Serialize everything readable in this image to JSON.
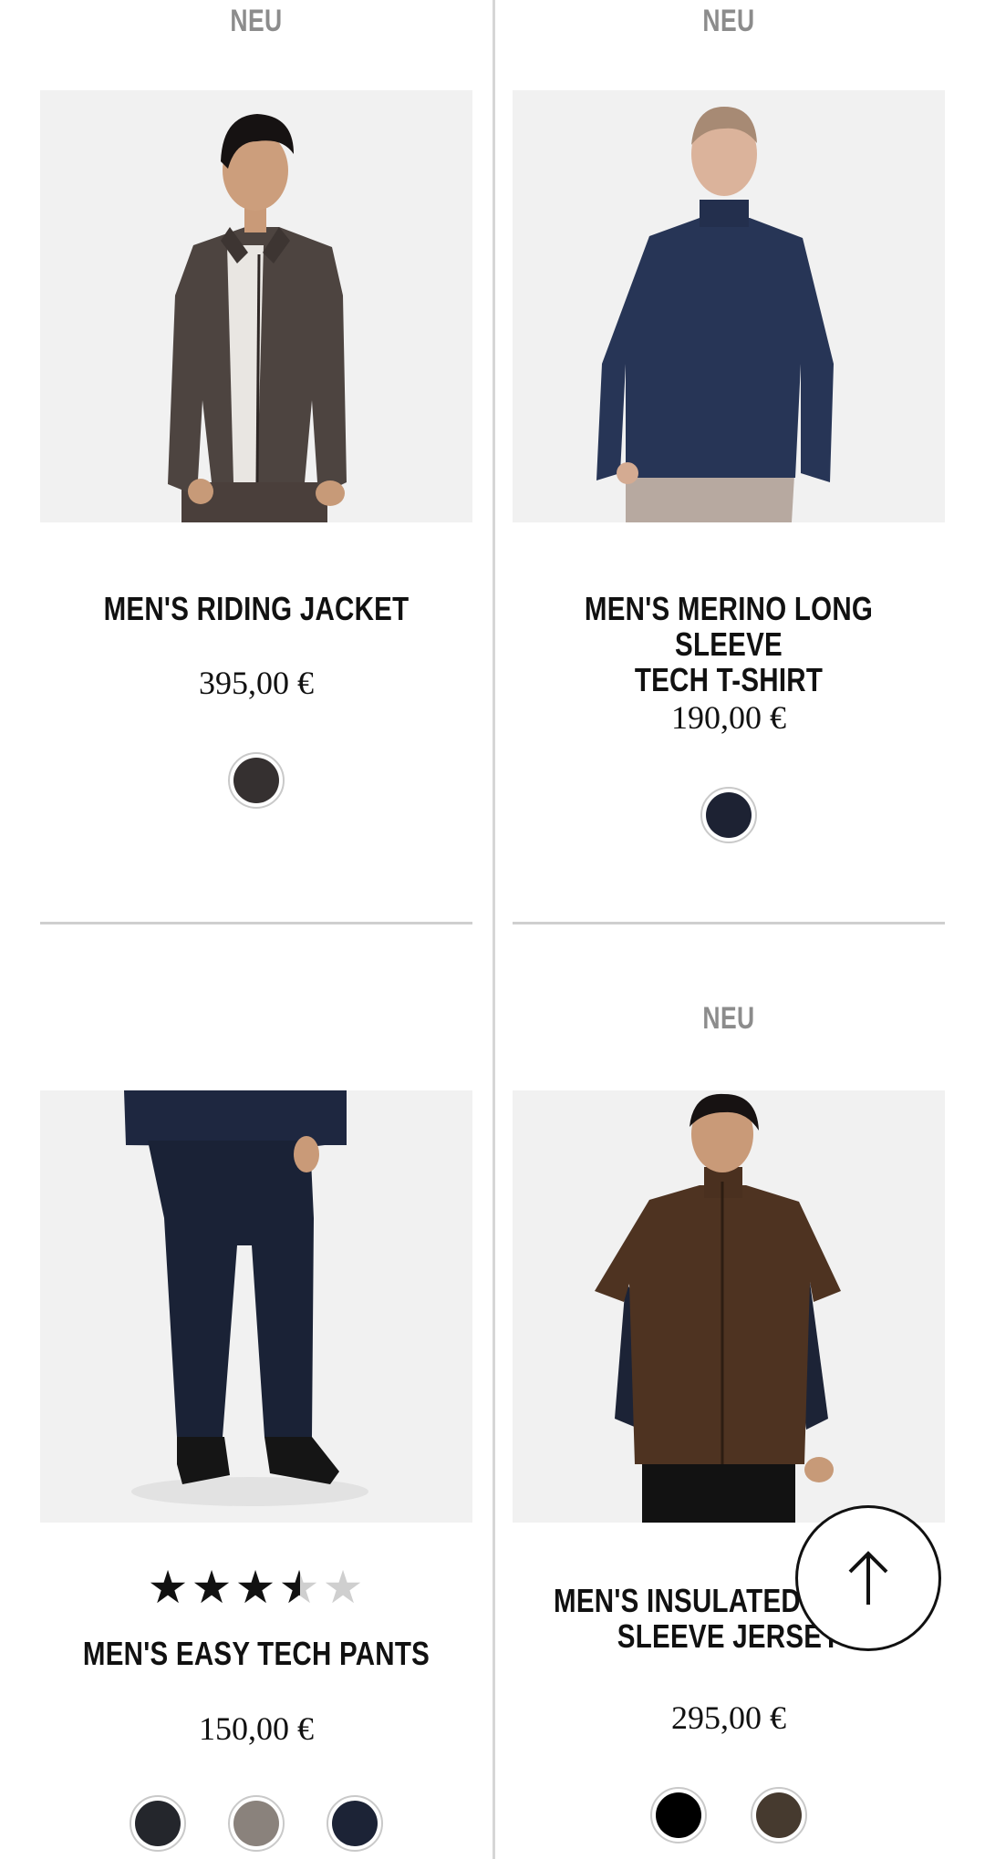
{
  "products": [
    {
      "badge": "NEU",
      "title_line1": "MEN'S RIDING JACKET",
      "title_line2": "",
      "price": "395,00 €",
      "image_icon": "jacket-model-photo",
      "swatches": [
        "#353030"
      ]
    },
    {
      "badge": "NEU",
      "title_line1": "MEN'S MERINO LONG SLEEVE",
      "title_line2": "TECH T-SHIRT",
      "price": "190,00 €",
      "image_icon": "tshirt-model-photo",
      "swatches": [
        "#1d2233"
      ]
    },
    {
      "badge": "",
      "rating": 3.5,
      "rating_max": 5,
      "title_line1": "MEN'S EASY TECH PANTS",
      "title_line2": "",
      "price": "150,00 €",
      "image_icon": "pants-model-photo",
      "swatches": [
        "#24262c",
        "#8a827c",
        "#1c2336"
      ]
    },
    {
      "badge": "NEU",
      "title_line1": "MEN'S INSULATED SHORT",
      "title_line2": "SLEEVE JERSEY",
      "price": "295,00 €",
      "image_icon": "jersey-model-photo",
      "swatches": [
        "#000000",
        "#463a2f"
      ]
    }
  ],
  "scroll_top": {
    "icon": "arrow-up-icon"
  },
  "colors": {
    "badge": "#8c8c8c",
    "text": "#111111",
    "image_bg": "#f1f1f1",
    "divider": "#d6d6d6"
  }
}
